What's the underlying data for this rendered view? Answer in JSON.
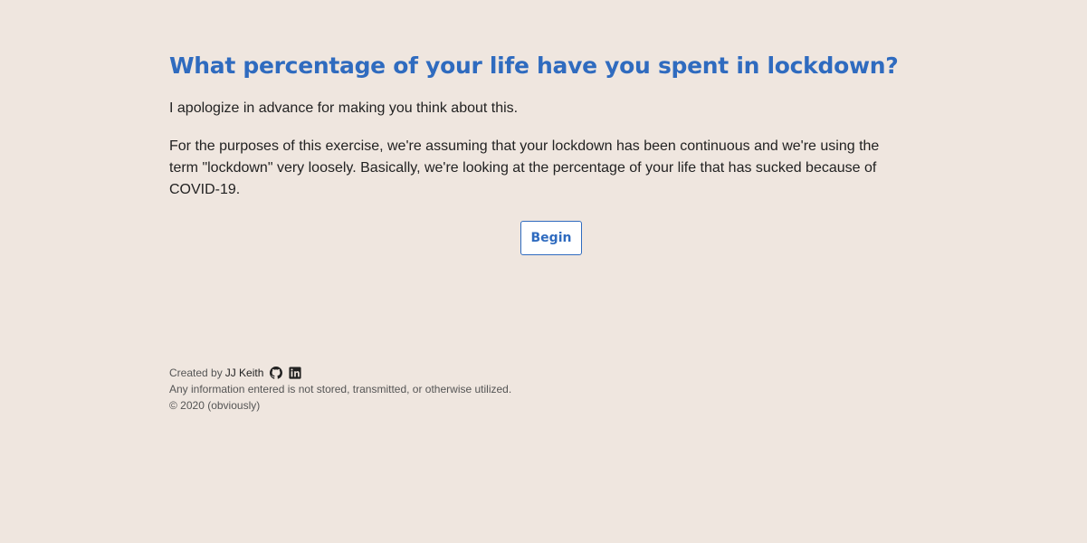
{
  "main": {
    "title": "What percentage of your life have you spent in lockdown?",
    "intro": "I apologize in advance for making you think about this.",
    "description": "For the purposes of this exercise, we're assuming that your lockdown has been continuous and we're using the term \"lockdown\" very loosely. Basically, we're looking at the percentage of your life that has sucked because of COVID-19.",
    "begin_label": "Begin"
  },
  "footer": {
    "created_by": "Created by",
    "author": "JJ Keith",
    "icons": [
      "github-icon",
      "linkedin-icon"
    ],
    "disclaimer": "Any information entered is not stored, transmitted, or otherwise utilized.",
    "copyright": "© 2020 (obviously)"
  },
  "colors": {
    "background": "#efe6df",
    "accent": "#2f6bbf",
    "text": "#222222"
  }
}
